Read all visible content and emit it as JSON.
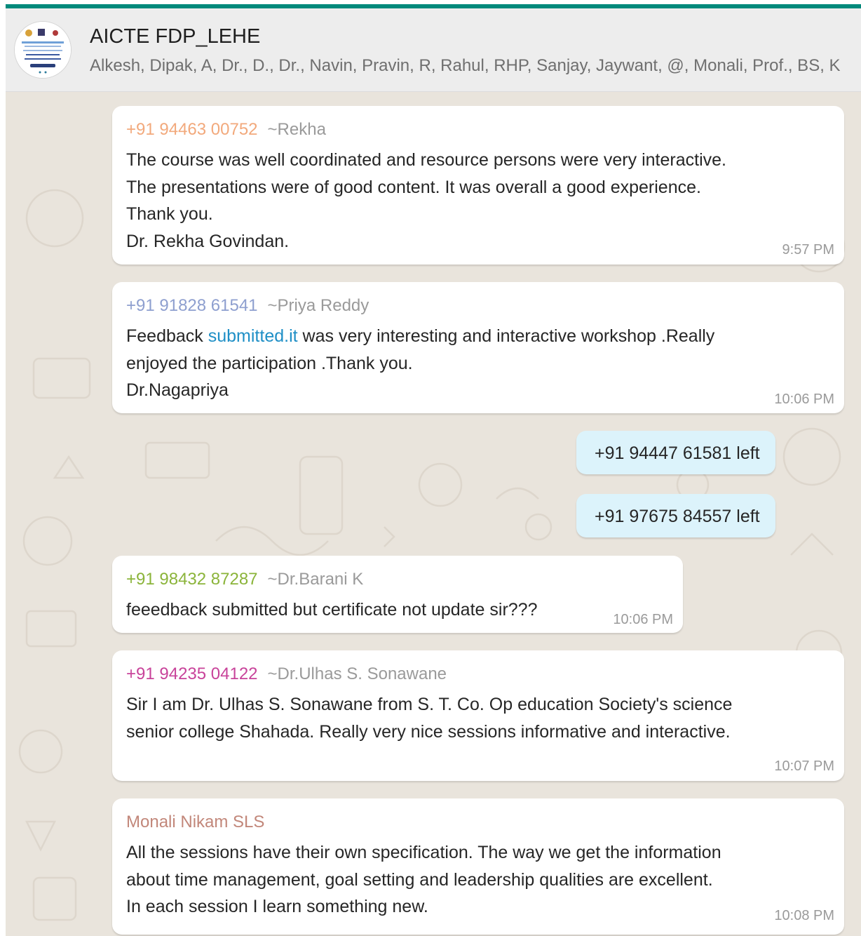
{
  "chat": {
    "title": "AICTE FDP_LEHE",
    "participants": "Alkesh, Dipak, A, Dr., D., Dr., Navin, Pravin, R, Rahul, RHP, Sanjay, Jaywant, @, Monali, Prof., BS, K"
  },
  "messages": [
    {
      "number": "+91 94463 00752",
      "alias": "~Rekha",
      "color": "#f2a97c",
      "lines": [
        "The course was well coordinated and resource persons were very interactive.",
        "The presentations were of good content. It was overall a good experience.",
        "Thank you.",
        "Dr. Rekha Govindan."
      ],
      "time": "9:57 PM"
    },
    {
      "number": "+91 91828 61541",
      "alias": "~Priya Reddy",
      "color": "#8e9fcf",
      "line1_pre": "Feedback ",
      "line1_link": "submitted.it",
      "line1_post": " was very interesting and interactive workshop .Really",
      "lines": [
        "enjoyed the participation .Thank you.",
        "Dr.Nagapriya"
      ],
      "time": "10:06 PM"
    },
    {
      "number": "+91 98432 87287",
      "alias": "~Dr.Barani K",
      "color": "#8bb43a",
      "lines": [
        "feeedback submitted but certificate not update sir???"
      ],
      "time": "10:06 PM"
    },
    {
      "number": "+91 94235 04122",
      "alias": "~Dr.Ulhas S. Sonawane",
      "color": "#c8439a",
      "lines": [
        "Sir I am Dr. Ulhas S. Sonawane  from S. T. Co. Op education Society's science",
        "senior college Shahada. Really very nice sessions informative and interactive."
      ],
      "time": "10:07 PM"
    },
    {
      "sender": "Monali Nikam SLS",
      "color": "#c2877a",
      "lines": [
        "All the sessions have their own specification. The way we get the information",
        "about time management, goal setting and leadership qualities are excellent.",
        "In each session I learn something new."
      ],
      "time": "10:08 PM"
    }
  ],
  "system": [
    {
      "text": "+91 94447 61581 left"
    },
    {
      "text": "+91 97675 84557 left"
    }
  ]
}
